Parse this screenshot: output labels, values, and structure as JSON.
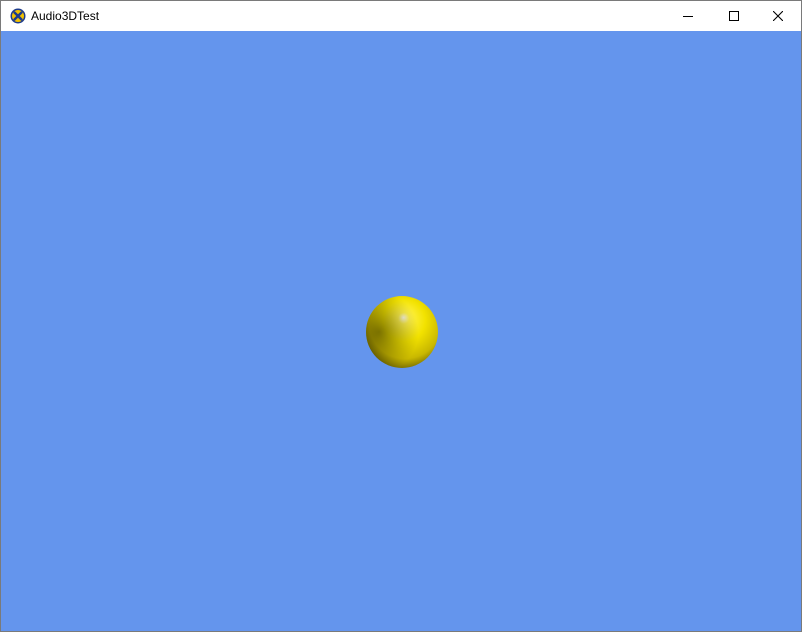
{
  "window": {
    "title": "Audio3DTest",
    "icon": "xna-game-icon"
  },
  "caption_buttons": {
    "minimize": "minimize-icon",
    "maximize": "maximize-icon",
    "close": "close-icon"
  },
  "scene": {
    "background_color": "#6495ed",
    "object": "yellow-sphere",
    "object_color": "#ffff00"
  }
}
